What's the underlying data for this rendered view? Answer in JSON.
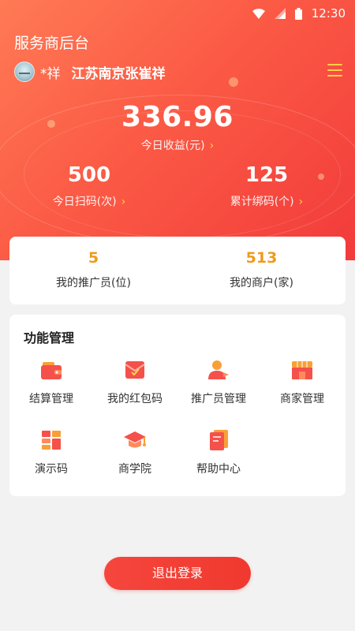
{
  "status_bar": {
    "time": "12:30"
  },
  "header": {
    "app_title": "服务商后台",
    "user_name": "*祥",
    "user_location": "江苏南京张崔祥"
  },
  "today_income": {
    "value": "336.96",
    "label": "今日收益(元)"
  },
  "stats": {
    "today_scans": {
      "value": "500",
      "label": "今日扫码(次)"
    },
    "total_bound": {
      "value": "125",
      "label": "累计绑码(个)"
    }
  },
  "summary": {
    "promoters": {
      "value": "5",
      "label": "我的推广员(位)"
    },
    "merchants": {
      "value": "513",
      "label": "我的商户(家)"
    }
  },
  "functions": {
    "title": "功能管理",
    "items": [
      {
        "label": "结算管理",
        "icon": "wallet-icon"
      },
      {
        "label": "我的红包码",
        "icon": "envelope-icon"
      },
      {
        "label": "推广员管理",
        "icon": "person-icon"
      },
      {
        "label": "商家管理",
        "icon": "store-icon"
      },
      {
        "label": "演示码",
        "icon": "grid-icon"
      },
      {
        "label": "商学院",
        "icon": "graduation-cap-icon"
      },
      {
        "label": "帮助中心",
        "icon": "book-icon"
      }
    ]
  },
  "logout_label": "退出登录",
  "colors": {
    "hero_start": "#ff7a55",
    "hero_end": "#f23b3b",
    "accent_yellow": "#ffd04a",
    "summary_value": "#f09a1a",
    "icon_red": "#f4514a",
    "icon_orange": "#f8a037"
  }
}
